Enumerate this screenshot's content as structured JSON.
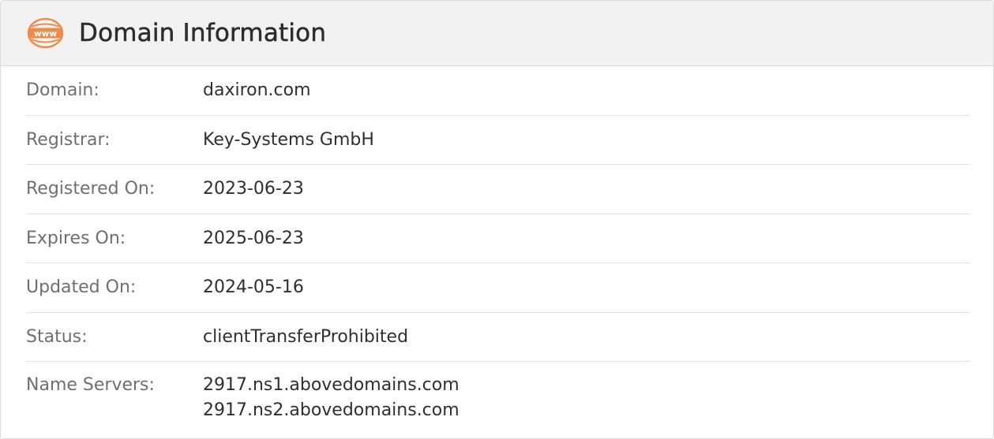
{
  "header": {
    "title": "Domain Information",
    "icon": "www-icon",
    "icon_text": "www",
    "accent_color": "#f08a4b"
  },
  "rows": [
    {
      "label": "Domain:",
      "value": "daxiron.com"
    },
    {
      "label": "Registrar:",
      "value": "Key-Systems GmbH"
    },
    {
      "label": "Registered On:",
      "value": "2023-06-23"
    },
    {
      "label": "Expires On:",
      "value": "2025-06-23"
    },
    {
      "label": "Updated On:",
      "value": "2024-05-16"
    },
    {
      "label": "Status:",
      "value": "clientTransferProhibited"
    }
  ],
  "name_servers": {
    "label": "Name Servers:",
    "values": [
      "2917.ns1.abovedomains.com",
      "2917.ns2.abovedomains.com"
    ]
  }
}
